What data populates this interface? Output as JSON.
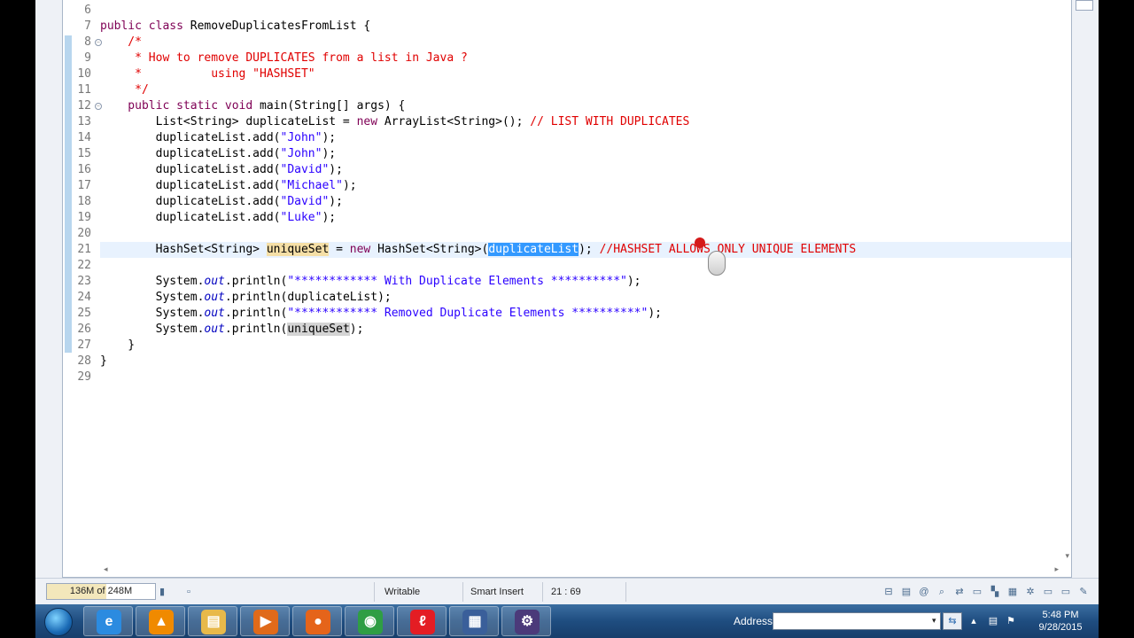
{
  "editor": {
    "lines": [
      {
        "num": "6",
        "segments": [
          {
            "t": "",
            "c": ""
          }
        ]
      },
      {
        "num": "7",
        "segments": [
          {
            "t": "public class ",
            "c": "kw"
          },
          {
            "t": "RemoveDuplicatesFromList {",
            "c": ""
          }
        ]
      },
      {
        "num": "8",
        "segments": [
          {
            "t": "    /*",
            "c": "cm"
          }
        ]
      },
      {
        "num": "9",
        "segments": [
          {
            "t": "     * How to remove DUPLICATES from a list in Java ?",
            "c": "cm"
          }
        ]
      },
      {
        "num": "10",
        "segments": [
          {
            "t": "     *          using \"HASHSET\"",
            "c": "cm"
          }
        ]
      },
      {
        "num": "11",
        "segments": [
          {
            "t": "     */",
            "c": "cm"
          }
        ]
      },
      {
        "num": "12",
        "segments": [
          {
            "t": "    public static void ",
            "c": "kw"
          },
          {
            "t": "main(String[] args) {",
            "c": ""
          }
        ]
      },
      {
        "num": "13",
        "segments": [
          {
            "t": "        List<String> duplicateList = ",
            "c": ""
          },
          {
            "t": "new ",
            "c": "kw"
          },
          {
            "t": "ArrayList<String>(); ",
            "c": ""
          },
          {
            "t": "// LIST WITH DUPLICATES",
            "c": "cm"
          }
        ]
      },
      {
        "num": "14",
        "segments": [
          {
            "t": "        duplicateList.add(",
            "c": ""
          },
          {
            "t": "\"John\"",
            "c": "st"
          },
          {
            "t": ");",
            "c": ""
          }
        ]
      },
      {
        "num": "15",
        "segments": [
          {
            "t": "        duplicateList.add(",
            "c": ""
          },
          {
            "t": "\"John\"",
            "c": "st"
          },
          {
            "t": ");",
            "c": ""
          }
        ]
      },
      {
        "num": "16",
        "segments": [
          {
            "t": "        duplicateList.add(",
            "c": ""
          },
          {
            "t": "\"David\"",
            "c": "st"
          },
          {
            "t": ");",
            "c": ""
          }
        ]
      },
      {
        "num": "17",
        "segments": [
          {
            "t": "        duplicateList.add(",
            "c": ""
          },
          {
            "t": "\"Michael\"",
            "c": "st"
          },
          {
            "t": ");",
            "c": ""
          }
        ]
      },
      {
        "num": "18",
        "segments": [
          {
            "t": "        duplicateList.add(",
            "c": ""
          },
          {
            "t": "\"David\"",
            "c": "st"
          },
          {
            "t": ");",
            "c": ""
          }
        ]
      },
      {
        "num": "19",
        "segments": [
          {
            "t": "        duplicateList.add(",
            "c": ""
          },
          {
            "t": "\"Luke\"",
            "c": "st"
          },
          {
            "t": ");",
            "c": ""
          }
        ]
      },
      {
        "num": "20",
        "segments": [
          {
            "t": "",
            "c": ""
          }
        ]
      },
      {
        "num": "21",
        "current": true,
        "segments": [
          {
            "t": "        HashSet<String> ",
            "c": ""
          },
          {
            "t": "uniqueSet",
            "c": "hl"
          },
          {
            "t": " = ",
            "c": ""
          },
          {
            "t": "new ",
            "c": "kw"
          },
          {
            "t": "HashSet<String>(",
            "c": ""
          },
          {
            "t": "duplicateList",
            "c": "sel"
          },
          {
            "t": "); ",
            "c": ""
          },
          {
            "t": "//HASHSET ALLOWS ONLY UNIQUE ELEMENTS",
            "c": "cm"
          }
        ]
      },
      {
        "num": "22",
        "segments": [
          {
            "t": "",
            "c": ""
          }
        ]
      },
      {
        "num": "23",
        "segments": [
          {
            "t": "        System.",
            "c": ""
          },
          {
            "t": "out",
            "c": "it"
          },
          {
            "t": ".println(",
            "c": ""
          },
          {
            "t": "\"************ With Duplicate Elements **********\"",
            "c": "st"
          },
          {
            "t": ");",
            "c": ""
          }
        ]
      },
      {
        "num": "24",
        "segments": [
          {
            "t": "        System.",
            "c": ""
          },
          {
            "t": "out",
            "c": "it"
          },
          {
            "t": ".println(duplicateList);",
            "c": ""
          }
        ]
      },
      {
        "num": "25",
        "segments": [
          {
            "t": "        System.",
            "c": ""
          },
          {
            "t": "out",
            "c": "it"
          },
          {
            "t": ".println(",
            "c": ""
          },
          {
            "t": "\"************ Removed Duplicate Elements **********\"",
            "c": "st"
          },
          {
            "t": ");",
            "c": ""
          }
        ]
      },
      {
        "num": "26",
        "segments": [
          {
            "t": "        System.",
            "c": ""
          },
          {
            "t": "out",
            "c": "it"
          },
          {
            "t": ".println(",
            "c": ""
          },
          {
            "t": "uniqueSet",
            "c": "occ"
          },
          {
            "t": ");",
            "c": ""
          }
        ]
      },
      {
        "num": "27",
        "segments": [
          {
            "t": "    }",
            "c": ""
          }
        ]
      },
      {
        "num": "28",
        "segments": [
          {
            "t": "}",
            "c": ""
          }
        ]
      },
      {
        "num": "29",
        "segments": [
          {
            "t": "",
            "c": ""
          }
        ]
      }
    ]
  },
  "statusbar": {
    "heap": "136M of 248M",
    "writable": "Writable",
    "insert_mode": "Smart Insert",
    "position": "21 : 69"
  },
  "taskbar": {
    "apps": [
      {
        "name": "ie-icon",
        "glyph": "e",
        "color": "#2b8be0"
      },
      {
        "name": "vlc-icon",
        "glyph": "▲",
        "color": "#f08a00"
      },
      {
        "name": "folder-icon",
        "glyph": "▤",
        "color": "#e8b94a"
      },
      {
        "name": "media-player-icon",
        "glyph": "▶",
        "color": "#e06a1a"
      },
      {
        "name": "firefox-icon",
        "glyph": "●",
        "color": "#e5641a"
      },
      {
        "name": "chrome-icon",
        "glyph": "◉",
        "color": "#2f9e44"
      },
      {
        "name": "airtel-icon",
        "glyph": "ℓ",
        "color": "#e41d24"
      },
      {
        "name": "save-disk-icon",
        "glyph": "▦",
        "color": "#3a5f9a"
      },
      {
        "name": "java-ee-ide-icon",
        "glyph": "⚙",
        "color": "#4b3a7a"
      }
    ],
    "address_label": "Address",
    "address_value": "",
    "clock_time": "5:48 PM",
    "clock_date": "9/28/2015"
  },
  "colors": {
    "keyword": "#7f0055",
    "comment": "#e00000",
    "string": "#2a00ff",
    "selection": "#3399ff",
    "occurrence": "#f5dfa6"
  }
}
